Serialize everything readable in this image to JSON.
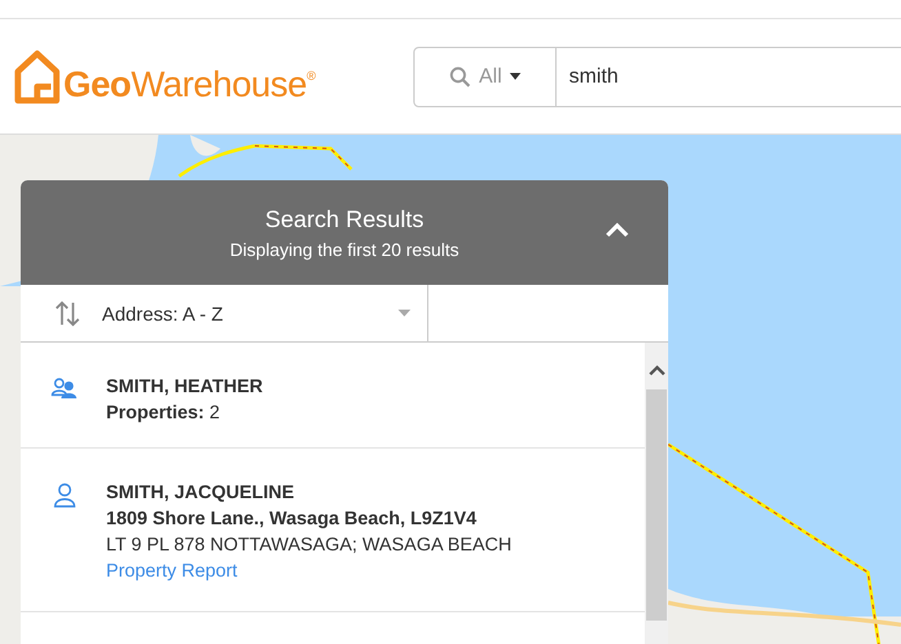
{
  "header": {
    "logo": "**Geo**Warehouse$^{®}$",
    "search": {
      "scope": "All",
      "value": "smith"
    }
  },
  "results_panel": {
    "title": "Search Results",
    "subtitle": "Displaying the first 20 results",
    "expanded": true,
    "sort": {
      "label": "Address: A - Z"
    },
    "results": [
      {
        "kind": "group",
        "name": "SMITH, HEATHER",
        "properties": "**Properties:** 2"
      },
      {
        "kind": "person",
        "name": "SMITH, JACQUELINE",
        "address": "1809 Shore Lane., Wasaga Beach, L9Z1V4",
        "legal": "LT 9 PL 878 NOTTAWASAGA; WASAGA BEACH",
        "link": "Property Report"
      }
    ]
  }
}
